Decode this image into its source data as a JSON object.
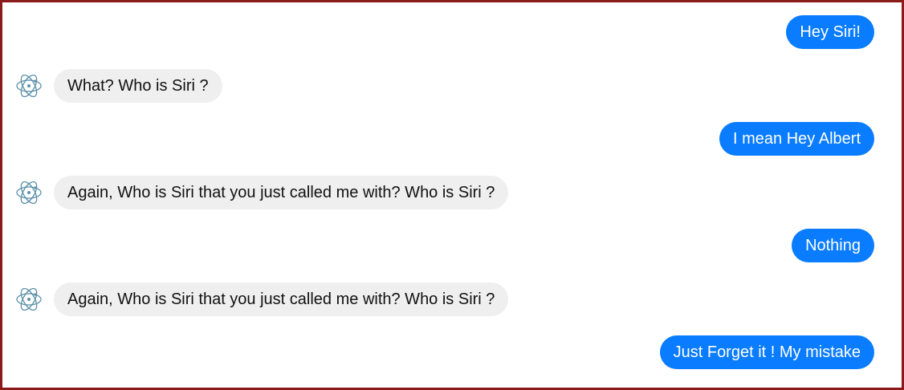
{
  "conversation": {
    "messages": [
      {
        "sender": "user",
        "text": "Hey Siri!"
      },
      {
        "sender": "bot",
        "text": "What? Who is Siri ?",
        "avatar_icon": "atom-logo-icon"
      },
      {
        "sender": "user",
        "text": "I mean Hey Albert"
      },
      {
        "sender": "bot",
        "text": "Again, Who is Siri that you just called me with? Who is Siri ?",
        "avatar_icon": "atom-logo-icon"
      },
      {
        "sender": "user",
        "text": "Nothing"
      },
      {
        "sender": "bot",
        "text": "Again, Who is Siri that you just called me with? Who is Siri ?",
        "avatar_icon": "atom-logo-icon"
      },
      {
        "sender": "user",
        "text": "Just Forget it ! My mistake"
      }
    ]
  },
  "colors": {
    "user_bubble": "#0a7cff",
    "bot_bubble": "#efefef",
    "frame_border": "#8b1a1a",
    "avatar_stroke": "#5a8fa8"
  }
}
